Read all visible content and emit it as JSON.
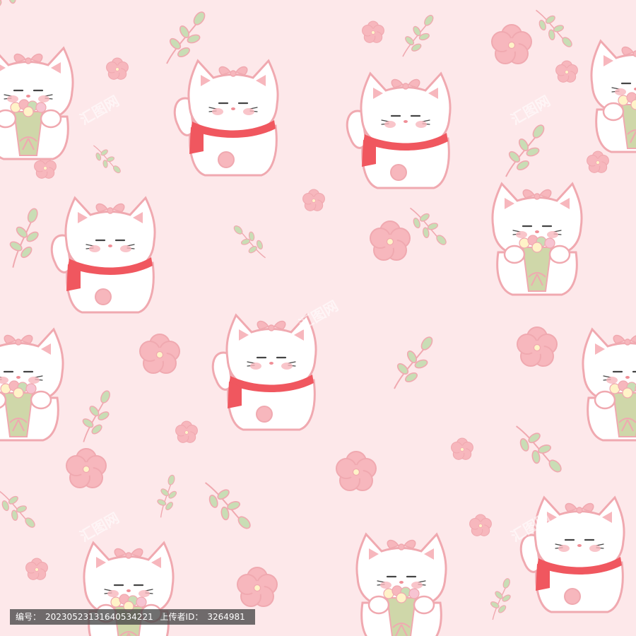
{
  "palette": {
    "background": "#fde8ea",
    "outline": "#f0a9b0",
    "scarf": "#f0575f",
    "cat_fill": "#ffffff",
    "flower_fill": "#f7b7bd",
    "flower_center": "#fff3c8",
    "leaf_fill": "#c9ddb5",
    "leaf_stroke": "#f0a9b0",
    "bouquet_wrap": "#cfd7a9"
  },
  "watermark": {
    "text": "汇图网",
    "footer": {
      "id_label": "编号：",
      "id_value": "20230523131640534221",
      "uploader_label": "上传者ID：",
      "uploader_value": "3264981"
    }
  },
  "icons": {
    "cat_scarf": "lucky-cat-scarf-icon",
    "cat_bouquet": "cat-with-bouquet-icon",
    "flower": "pink-flower-icon",
    "sprig": "leaf-sprig-icon"
  }
}
